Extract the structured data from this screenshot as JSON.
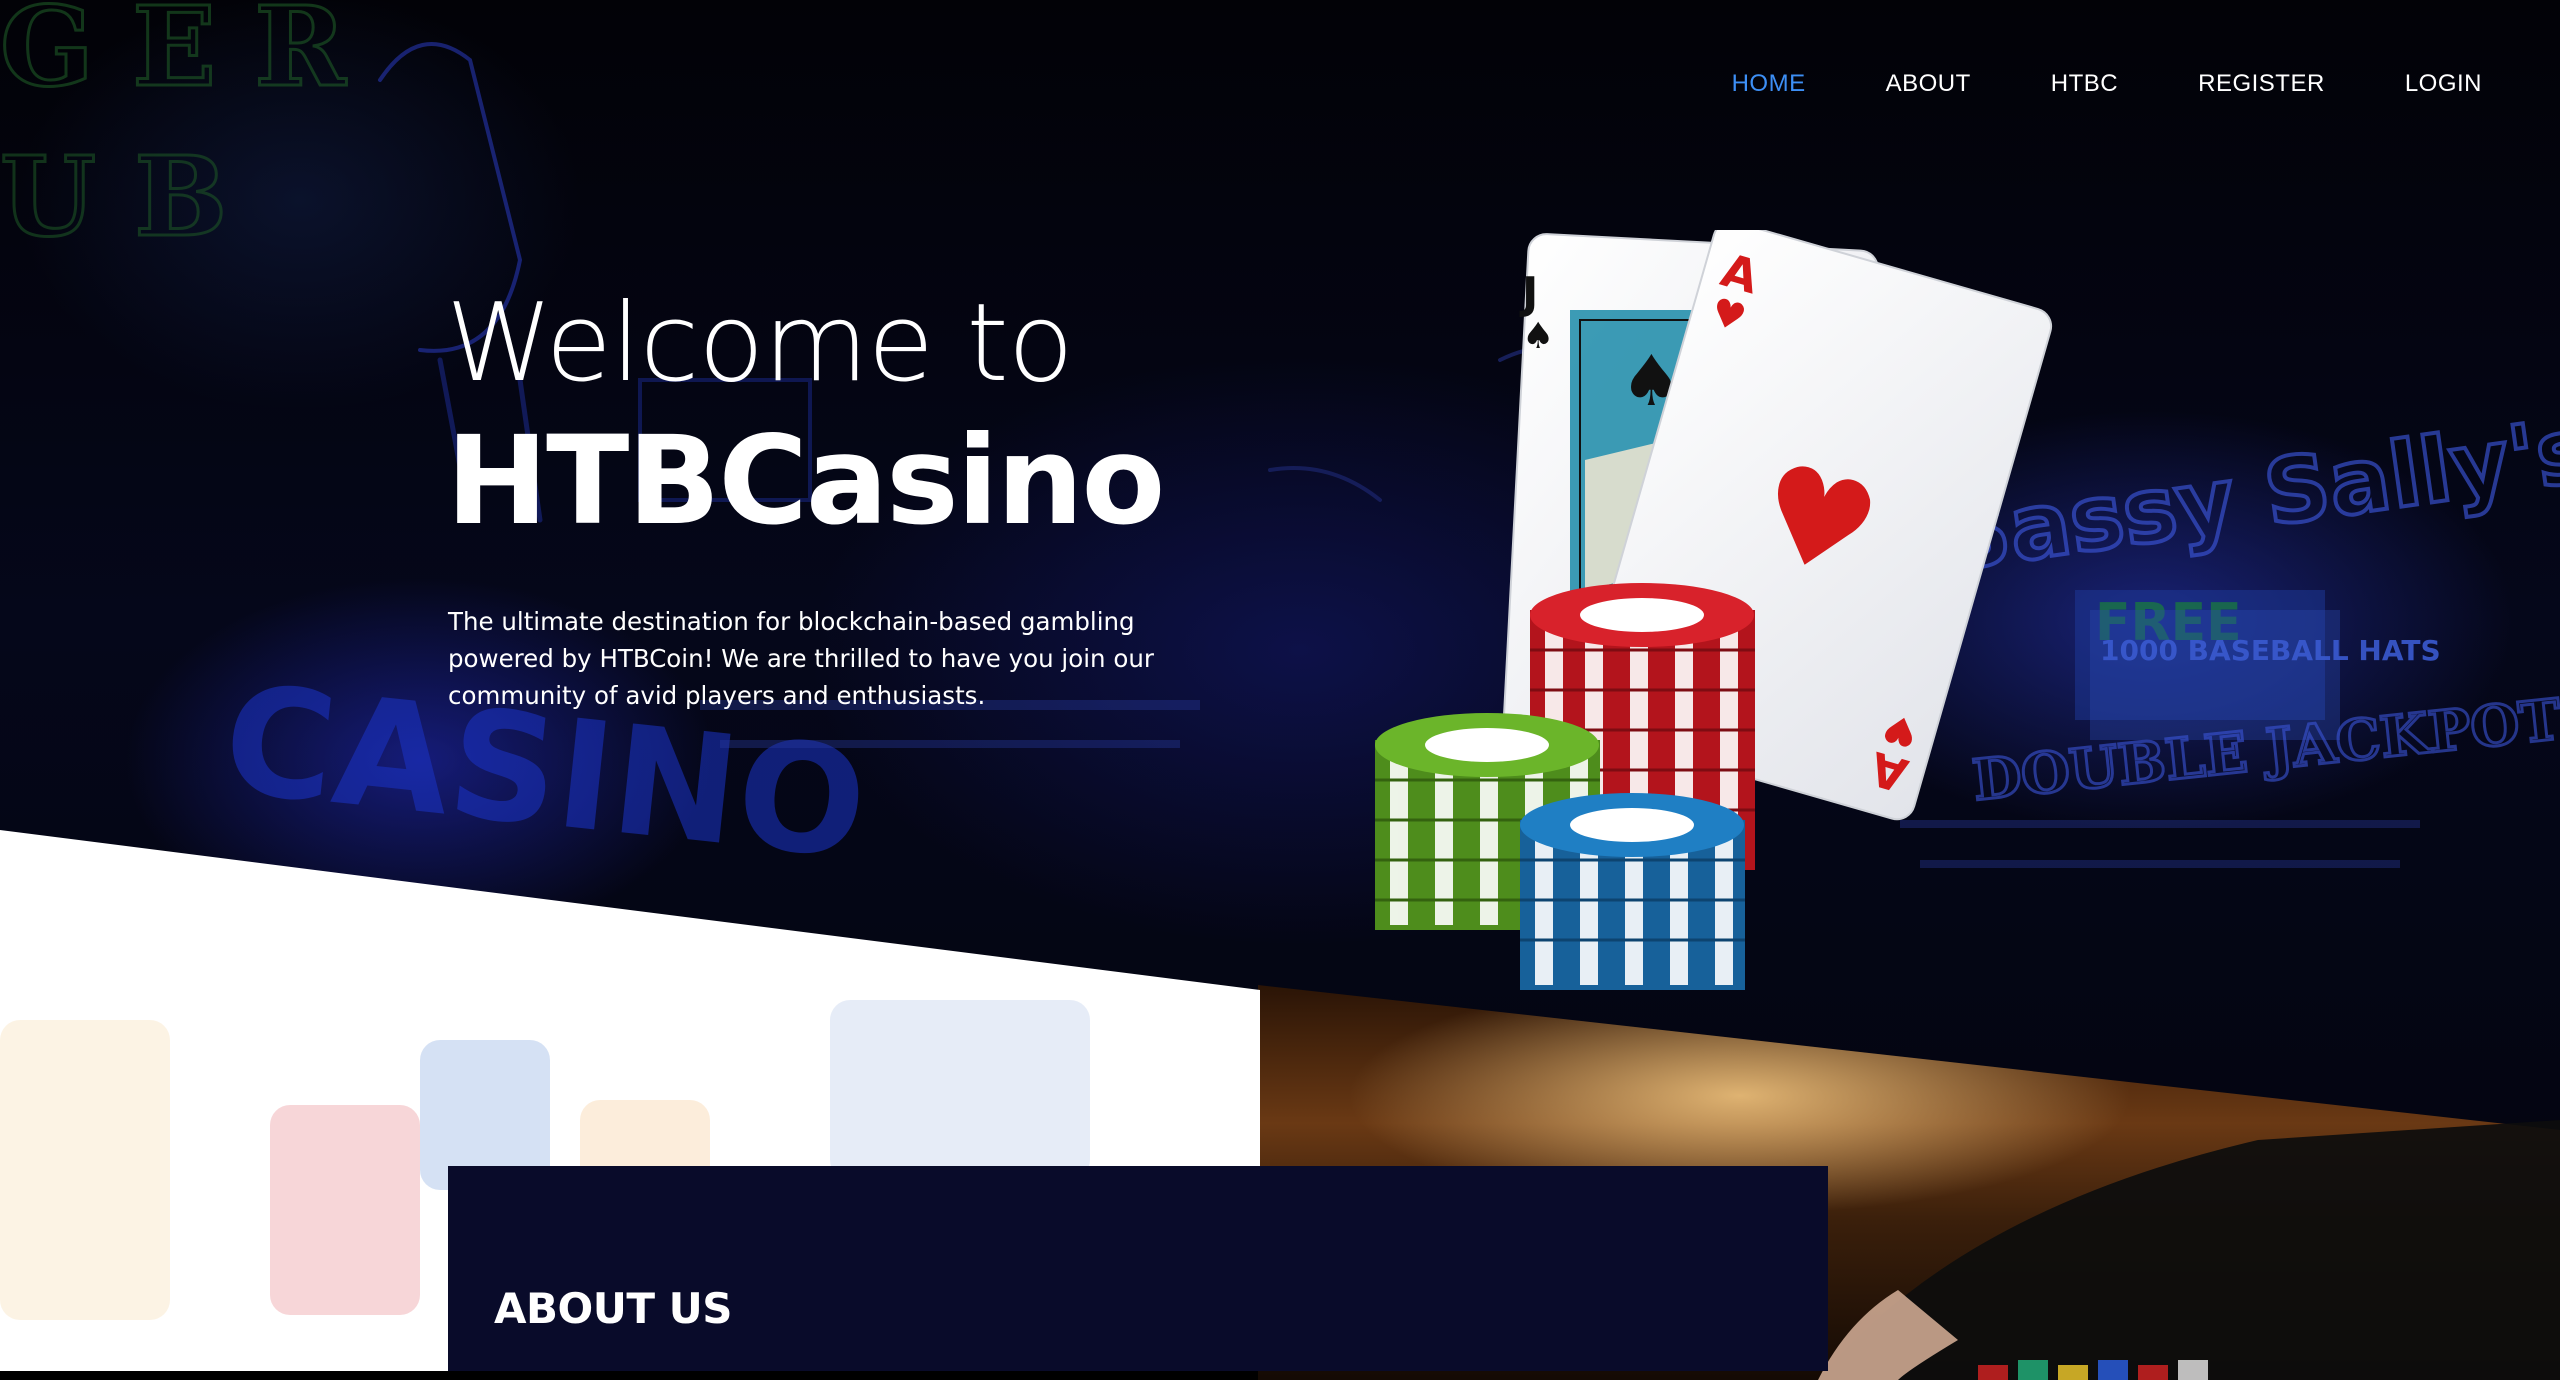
{
  "nav": {
    "items": [
      {
        "label": "HOME",
        "active": true
      },
      {
        "label": "ABOUT",
        "active": false
      },
      {
        "label": "HTBC",
        "active": false
      },
      {
        "label": "REGISTER",
        "active": false
      },
      {
        "label": "LOGIN",
        "active": false
      }
    ]
  },
  "hero": {
    "line1": "Welcome to",
    "line2": "HTBCasino",
    "description": "The ultimate destination for blockchain-based gambling powered by HTBCoin! We are thrilled to have you join our community of avid players and enthusiasts.",
    "background_neon": [
      "CASINO",
      "1000 BASEBALL HATS",
      "FREE",
      "DOUBLE JACKPOT",
      "Sassy Sally's"
    ],
    "cards": [
      {
        "rank": "J",
        "suit": "spade-icon"
      },
      {
        "rank": "A",
        "suit": "heart-icon"
      }
    ]
  },
  "about": {
    "title": "ABOUT US"
  },
  "colors": {
    "accent": "#3d8ff5",
    "about_bg": "#090b2a",
    "chip_red": "#d8222b",
    "chip_green": "#6bb52a",
    "chip_blue": "#1f7fc4"
  }
}
